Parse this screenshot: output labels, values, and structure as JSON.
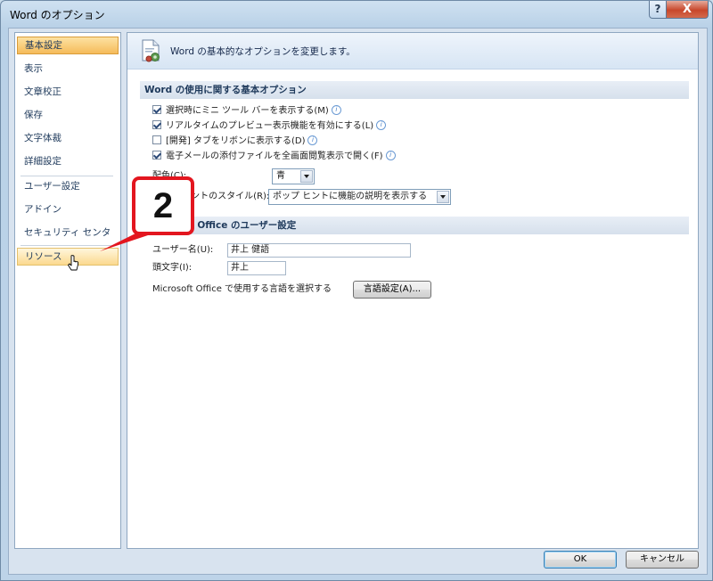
{
  "window": {
    "title": "Word のオプション",
    "help_label": "?",
    "close_label": "X"
  },
  "nav": {
    "items": [
      {
        "label": "基本設定",
        "state": "selected"
      },
      {
        "label": "表示"
      },
      {
        "label": "文章校正"
      },
      {
        "label": "保存"
      },
      {
        "label": "文字体裁"
      },
      {
        "label": "詳細設定"
      },
      {
        "label": "ユーザー設定"
      },
      {
        "label": "アドイン"
      },
      {
        "label": "セキュリティ センター"
      },
      {
        "label": "リソース",
        "state": "hover"
      }
    ]
  },
  "banner": {
    "text": "Word の基本的なオプションを変更します。",
    "icon": "options-document-icon"
  },
  "section1": {
    "title": "Word の使用に関する基本オプション",
    "checkboxes": [
      {
        "label": "選択時にミニ ツール バーを表示する(M)",
        "checked": true
      },
      {
        "label": "リアルタイムのプレビュー表示機能を有効にする(L)",
        "checked": true
      },
      {
        "label": "[開発] タブをリボンに表示する(D)",
        "checked": false
      },
      {
        "label": "電子メールの添付ファイルを全画面閲覧表示で開く(F)",
        "checked": true
      }
    ],
    "color_label": "配色(C):",
    "color_value": "青",
    "tip_label": "ポップ ヒントのスタイル(R):",
    "tip_value": "ポップ ヒントに機能の説明を表示する"
  },
  "section2": {
    "title": "Microsoft Office のユーザー設定",
    "username_label": "ユーザー名(U):",
    "username_value": "井上 健語",
    "initials_label": "頭文字(I):",
    "initials_value": "井上",
    "language_label": "Microsoft Office で使用する言語を選択する",
    "language_button": "言語設定(A)..."
  },
  "footer": {
    "ok_label": "OK",
    "cancel_label": "キャンセル"
  },
  "callout": {
    "label": "2",
    "color": "#e3161f"
  },
  "colors": {
    "accent_selected": "#f5bb5a",
    "nav_text": "#1e395b",
    "callout": "#e3161f"
  }
}
